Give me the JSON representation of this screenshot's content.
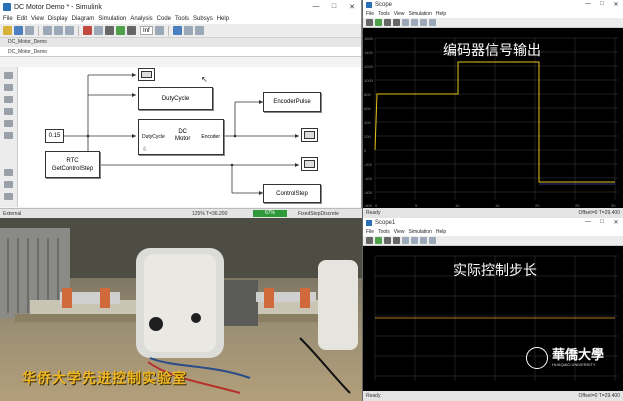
{
  "simulink": {
    "title": "DC Motor Demo * - Simulink",
    "menu": [
      "File",
      "Edit",
      "View",
      "Display",
      "Diagram",
      "Simulation",
      "Analysis",
      "Code",
      "Tools",
      "Subsys",
      "Help"
    ],
    "stop_time": "Inf",
    "tab": "DC_Motor_Demo",
    "breadcrumb": "DC_Motor_Demo",
    "blocks": {
      "constant": "0.15",
      "dutycycle": "DutyCycle",
      "motor_in": "DutyCycle",
      "motor_title": "DC\nMotor",
      "motor_out": "Encoder",
      "encoder_pulse": "EncoderPulse",
      "rtc_title": "RTC",
      "rtc_sub": "GetControlStep",
      "control_step": "ControlStep"
    },
    "status": {
      "left": "External",
      "zoom": "125%   T=36.200",
      "progress": "67%",
      "progress_value": 0.67,
      "solver": "FixedStepDiscrete"
    }
  },
  "scope1": {
    "title": "Scope",
    "menu": [
      "File",
      "Tools",
      "View",
      "Simulation",
      "Help"
    ],
    "overlay": "编码器信号输出",
    "status_left": "Ready",
    "status_right": "Offset=0  T=29.400",
    "y_labels": [
      "1600",
      "1400",
      "1200",
      "1000",
      "800",
      "600",
      "400",
      "200",
      "0",
      "-200",
      "-400",
      "-600",
      "-800"
    ],
    "x_labels": [
      "0",
      "5",
      "10",
      "15",
      "20",
      "25",
      "30"
    ]
  },
  "scope2": {
    "title": "Scope1",
    "menu": [
      "File",
      "Tools",
      "View",
      "Simulation",
      "Help"
    ],
    "overlay": "实际控制步长",
    "status_left": "Ready",
    "status_right": "Offset=0  T=29.400"
  },
  "video": {
    "subtitle": "华侨大学先进控制实验室"
  },
  "watermark": {
    "name": "華僑大學",
    "sub": "HUAQIAO UNIVERSITY"
  }
}
